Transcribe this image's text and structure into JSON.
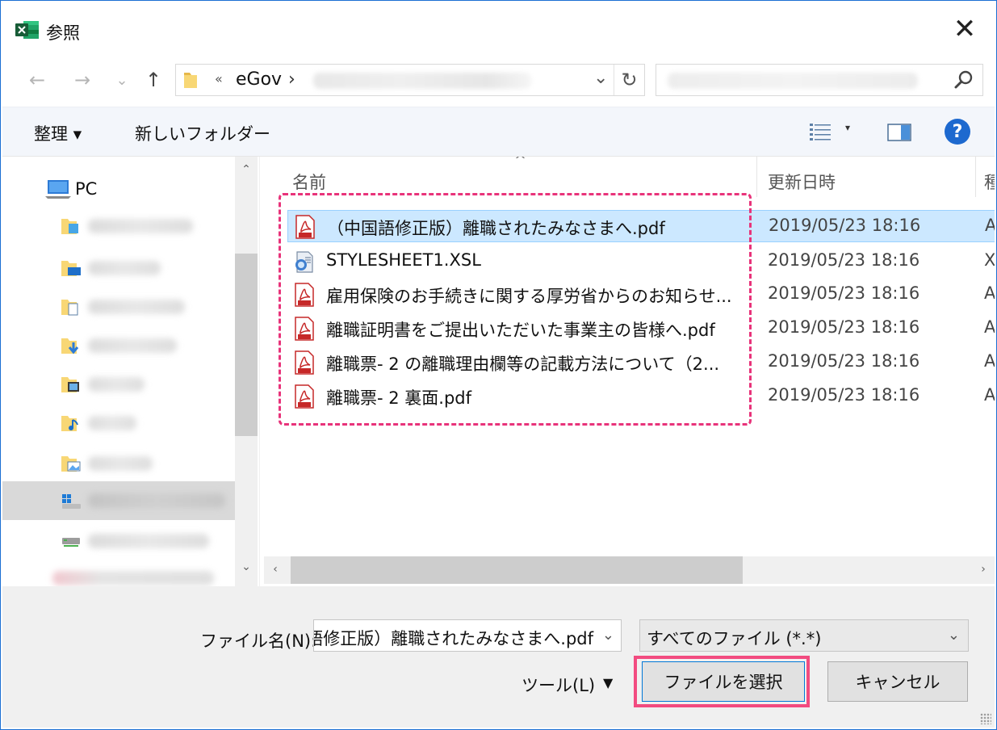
{
  "window": {
    "title": "参照",
    "close_glyph": "✕"
  },
  "nav": {
    "back_glyph": "←",
    "forward_glyph": "→",
    "recent_glyph": "⌄",
    "up_glyph": "↑",
    "address": {
      "overflow_glyph": "«",
      "crumb": "eGov",
      "separator": "›",
      "dropdown_glyph": "⌄",
      "refresh_glyph": "↻"
    }
  },
  "toolbar": {
    "organize": "整理 ▾",
    "new_folder": "新しいフォルダー",
    "view_dropdown": "▾",
    "help": "?"
  },
  "tree": {
    "pc_label": "PC",
    "scroll_up": "⌃",
    "scroll_down": "⌄"
  },
  "file_list": {
    "sort_indicator": "^",
    "columns": {
      "name": "名前",
      "date": "更新日時",
      "type": "種"
    },
    "rows": [
      {
        "name": "（中国語修正版）離職されたみなさまへ.pdf",
        "date": "2019/05/23 18:16",
        "type": "A",
        "icon": "pdf-icon"
      },
      {
        "name": "STYLESHEET1.XSL",
        "date": "2019/05/23 18:16",
        "type": "X",
        "icon": "xsl-icon"
      },
      {
        "name": "雇用保険のお手続きに関する厚労省からのお知らせ...",
        "date": "2019/05/23 18:16",
        "type": "A",
        "icon": "pdf-icon"
      },
      {
        "name": "離職証明書をご提出いただいた事業主の皆様へ.pdf",
        "date": "2019/05/23 18:16",
        "type": "A",
        "icon": "pdf-icon"
      },
      {
        "name": "離職票- 2 の離職理由欄等の記載方法について（2...",
        "date": "2019/05/23 18:16",
        "type": "A",
        "icon": "pdf-icon"
      },
      {
        "name": "離職票- 2 裏面.pdf",
        "date": "2019/05/23 18:16",
        "type": "A",
        "icon": "pdf-icon"
      }
    ],
    "scroll_left": "‹",
    "scroll_right": "›"
  },
  "bottom": {
    "filename_label": "ファイル名(N):",
    "filename_value": "(中国語修正版）離職されたみなさまへ.pdf",
    "filename_dropdown": "⌄",
    "filetype_value": "すべてのファイル (*.*)",
    "filetype_dropdown": "⌄",
    "tools_label": "ツール(L)",
    "tools_dropdown": "▼",
    "open_button": "ファイルを選択",
    "cancel_button": "キャンセル"
  },
  "colors": {
    "accent": "#1b6fd3",
    "highlight": "#e8337a",
    "selection": "#cce8ff"
  }
}
